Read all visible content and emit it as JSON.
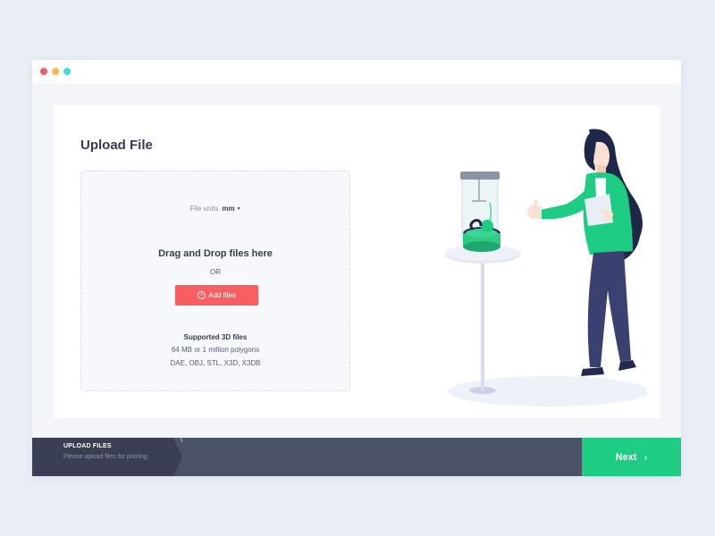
{
  "colors": {
    "page_bg": "#e9edf5",
    "window_dot_red": "#f2596b",
    "window_dot_yellow": "#f8b94b",
    "window_dot_teal": "#3fdcd3",
    "accent_red": "#f95e63",
    "accent_green": "#1fcc84",
    "footer_bg": "#4b5167",
    "footer_step_bg": "#3a3f54",
    "text_dark": "#353b52"
  },
  "upload": {
    "title": "Upload File",
    "units_label": "File units",
    "units_value": "mm",
    "drag_text": "Drag and Drop files here",
    "or_text": "OR",
    "add_button": "Add files",
    "supported_title": "Supported 3D files",
    "supported_limit": "64 MB or 1 million polygons",
    "supported_formats": "DAE, OBJ, STL, X3D, X3DB"
  },
  "footer": {
    "step_label": "UPLOAD FILES",
    "step_hint": "Please upload files for printing",
    "next_button": "Next"
  },
  "icons": {
    "add": "plus-circle-icon",
    "units_caret": "caret-down-icon",
    "next": "chevron-right-icon"
  }
}
